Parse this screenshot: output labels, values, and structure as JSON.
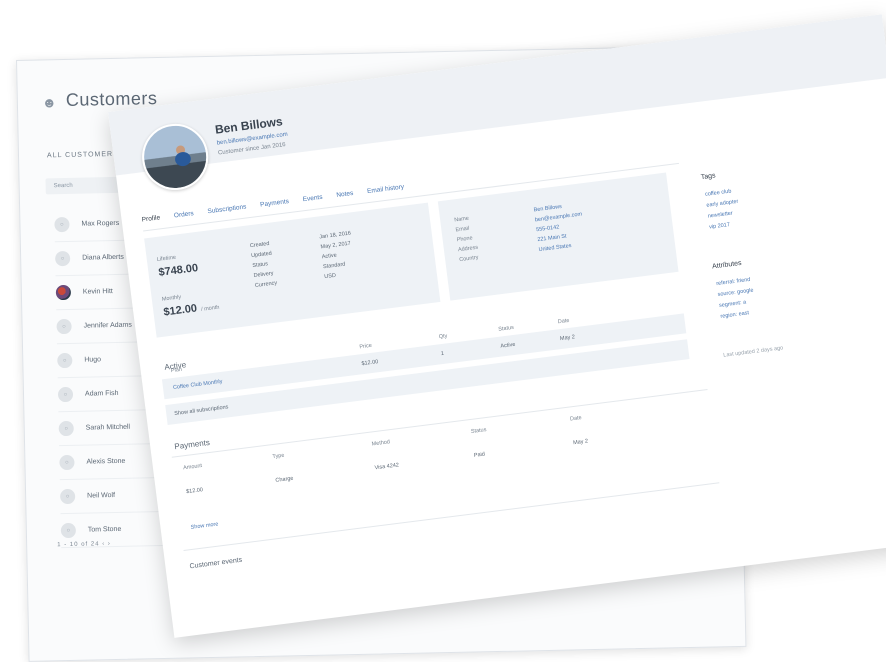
{
  "back": {
    "title": "Customers",
    "subheading": "ALL CUSTOMERS",
    "search_placeholder": "Search",
    "customers": [
      {
        "name": "Max Rogers",
        "photo": false
      },
      {
        "name": "Diana Alberts",
        "photo": false
      },
      {
        "name": "Kevin Hitt",
        "photo": true
      },
      {
        "name": "Jennifer Adams",
        "photo": false
      },
      {
        "name": "Hugo",
        "photo": false
      },
      {
        "name": "Adam Fish",
        "photo": false
      },
      {
        "name": "Sarah Mitchell",
        "photo": false
      },
      {
        "name": "Alexis Stone",
        "photo": false
      },
      {
        "name": "Neil Wolf",
        "photo": false
      },
      {
        "name": "Tom Stone",
        "photo": false
      }
    ],
    "pager": "1 - 10 of 24   ‹   ›"
  },
  "front": {
    "customer_name": "Ben Billows",
    "email": "ben.billows@example.com",
    "meta": "Customer since Jan 2016",
    "tabs": [
      "Profile",
      "Orders",
      "Subscriptions",
      "Payments",
      "Events",
      "Notes",
      "Email history"
    ],
    "summary": {
      "lifetime_label": "Lifetime",
      "lifetime_value": "$748.00",
      "monthly_label": "Monthly",
      "monthly_value": "$12.00",
      "monthly_unit": "/ month",
      "details_left": [
        "Created",
        "Updated",
        "Status",
        "Delivery",
        "Currency"
      ],
      "details_right": [
        "Jan 18, 2016",
        "May 2, 2017",
        "Active",
        "Standard",
        "USD"
      ]
    },
    "contact": {
      "labels": [
        "Name",
        "Email",
        "Phone",
        "Address",
        "Country"
      ],
      "values": [
        "Ben Billows",
        "ben@example.com",
        "555-0142",
        "221 Main St",
        "United States"
      ]
    },
    "orders": {
      "title": "Active",
      "headers": [
        "Plan",
        "Price",
        "Qty",
        "Status",
        "Date"
      ],
      "rows": [
        {
          "cells": [
            "Coffee Club Monthly",
            "$12.00",
            "1",
            "Active",
            "May 2"
          ]
        }
      ],
      "footer": "Show all subscriptions"
    },
    "payments": {
      "title": "Payments",
      "headers": [
        "Amount",
        "Type",
        "Method",
        "Status",
        "Date"
      ],
      "rows": [
        {
          "cells": [
            "$12.00",
            "Charge",
            "Visa 4242",
            "Paid",
            "May 2"
          ]
        }
      ],
      "more": "Show more"
    },
    "footer_title": "Customer events",
    "side": {
      "title1": "Tags",
      "tags": [
        "coffee club",
        "early adopter",
        "newsletter",
        "vip 2017"
      ],
      "title2": "Attributes",
      "attrs": [
        "referral: friend",
        "source: google",
        "segment: a",
        "region: east"
      ],
      "note": "Last updated 2 days ago"
    }
  }
}
